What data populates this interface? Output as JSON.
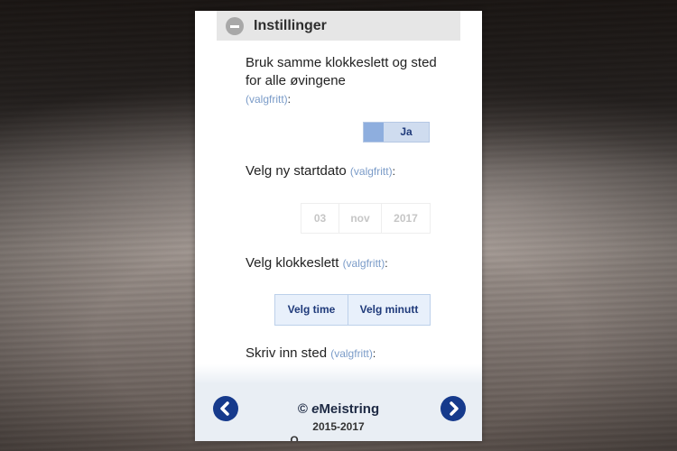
{
  "section": {
    "title": "Instillinger"
  },
  "same_time": {
    "label": "Bruk samme klokkeslett og sted for alle øvingene",
    "optional": "(valgfritt)",
    "colon": ":",
    "toggle_label": "Ja",
    "toggle_on": true
  },
  "start_date": {
    "label": "Velg ny startdato",
    "optional": "(valgfritt)",
    "colon": ":",
    "day": "03",
    "month": "nov",
    "year": "2017"
  },
  "time": {
    "label": "Velg klokkeslett",
    "optional": "(valgfritt)",
    "colon": ":",
    "hour_button": "Velg time",
    "minute_button": "Velg minutt"
  },
  "place": {
    "label": "Skriv inn sted",
    "optional": "(valgfritt)",
    "colon": ":"
  },
  "footer": {
    "copyright": "©",
    "brand_prefix": "e",
    "brand_rest": "Meistring",
    "years": "2015-2017",
    "cutoff_text": "O . . . . . . . . ."
  },
  "colors": {
    "accent": "#163a8c",
    "optional_text": "#7a9bc8",
    "toggle_bg": "#cfdcef",
    "toggle_knob": "#8eaede",
    "footer_bg": "#e9eef4"
  },
  "icons": {
    "section": "minus-circle-icon",
    "prev": "chevron-left-icon",
    "next": "chevron-right-icon"
  }
}
